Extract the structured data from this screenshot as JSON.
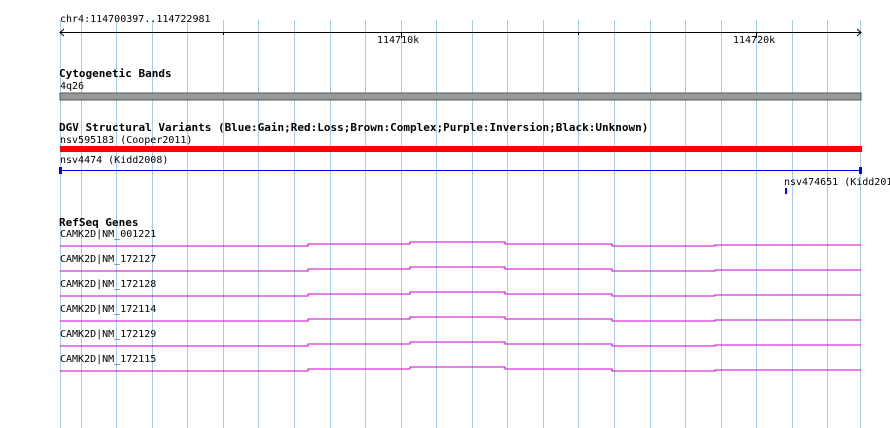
{
  "ruler": {
    "coordinate_label": "chr4:114700397..114722981",
    "tick_labels": [
      "114710k",
      "114720k"
    ]
  },
  "tracks": {
    "cytogenetic": {
      "title": "Cytogenetic Bands",
      "band_label": "4q26",
      "band_color": "#999999"
    },
    "dgv": {
      "title": "DGV Structural Variants (Blue:Gain;Red:Loss;Brown:Complex;Purple:Inversion;Black:Unknown)",
      "variants": [
        {
          "label": "nsv595183 (Cooper2011)",
          "color": "#ff0000"
        },
        {
          "label": "nsv4474 (Kidd2008)",
          "color": "#0000ff"
        },
        {
          "label": "nsv474651 (Kidd201",
          "color": "#0000ff"
        }
      ]
    },
    "refseq": {
      "title": "RefSeq Genes",
      "gene_color": "#cc00cc",
      "genes": [
        {
          "label": "CAMK2D|NM_001221"
        },
        {
          "label": "CAMK2D|NM_172127"
        },
        {
          "label": "CAMK2D|NM_172128"
        },
        {
          "label": "CAMK2D|NM_172114"
        },
        {
          "label": "CAMK2D|NM_172129"
        },
        {
          "label": "CAMK2D|NM_172115"
        }
      ]
    }
  },
  "colors": {
    "gridline": "#a8cde6",
    "ruler": "#000000"
  }
}
